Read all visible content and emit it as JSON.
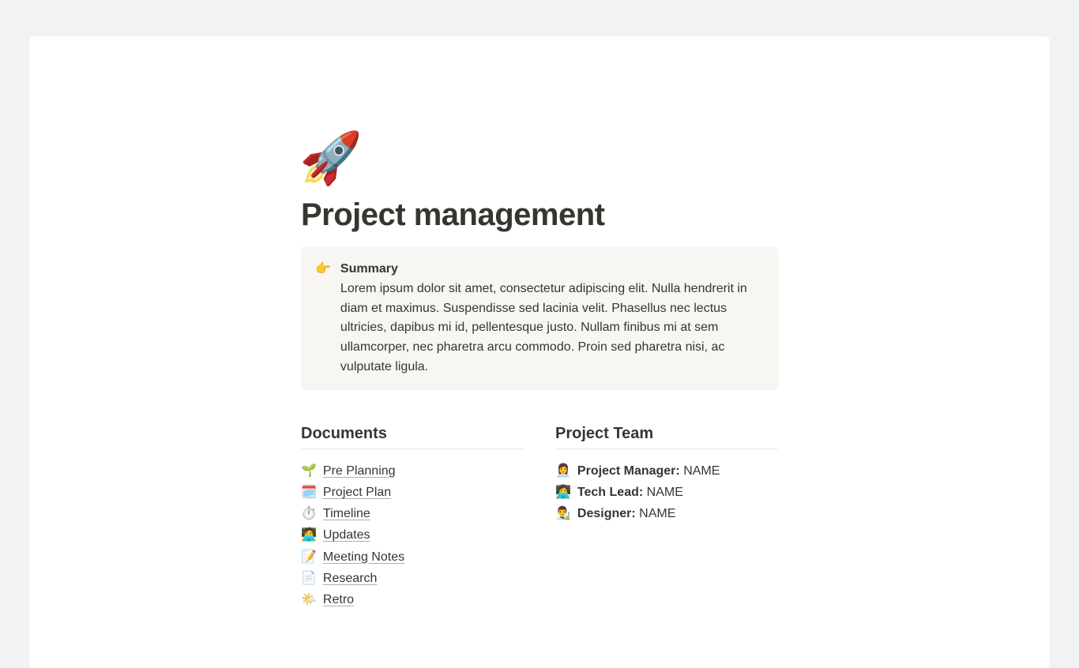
{
  "header": {
    "icon": "🚀",
    "title": "Project management"
  },
  "callout": {
    "icon": "👉",
    "title": "Summary",
    "text": "Lorem ipsum dolor sit amet, consectetur adipiscing elit. Nulla hendrerit in diam et maximus. Suspendisse sed lacinia velit. Phasellus nec lectus ultricies, dapibus mi id, pellentesque justo. Nullam finibus mi at sem ullamcorper, nec pharetra arcu commodo. Proin sed pharetra nisi, ac vulputate ligula."
  },
  "documents": {
    "heading": "Documents",
    "items": [
      {
        "emoji": "🌱",
        "label": "Pre Planning"
      },
      {
        "emoji": "🗓️",
        "label": "Project Plan"
      },
      {
        "emoji": "⏱️",
        "label": "Timeline"
      },
      {
        "emoji": "🧑‍💻",
        "label": "Updates"
      },
      {
        "emoji": "📝",
        "label": "Meeting Notes"
      },
      {
        "emoji": "📄",
        "label": "Research"
      },
      {
        "emoji": "🌤️",
        "label": "Retro"
      }
    ]
  },
  "team": {
    "heading": "Project Team",
    "items": [
      {
        "emoji": "👩‍💼",
        "role": "Project Manager:",
        "name": "NAME"
      },
      {
        "emoji": "👩‍💻",
        "role": "Tech Lead:",
        "name": "NAME"
      },
      {
        "emoji": "👨‍🎨",
        "role": "Designer:",
        "name": "NAME"
      }
    ]
  }
}
